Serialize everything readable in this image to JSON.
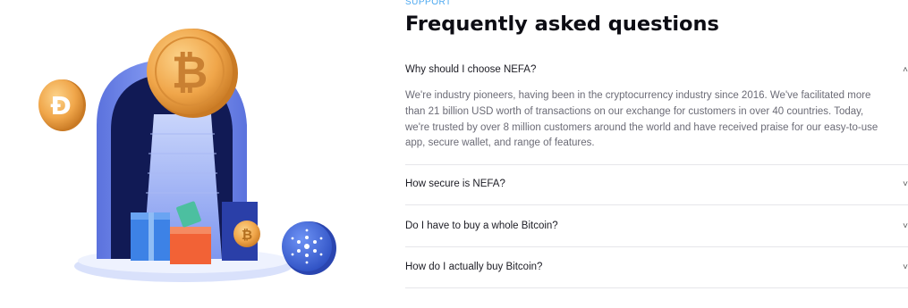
{
  "faq": {
    "eyebrow": "SUPPORT",
    "title": "Frequently asked  questions",
    "items": [
      {
        "question": "Why should I choose NEFA?",
        "expanded": true,
        "answer": "We're industry pioneers, having been in the cryptocurrency industry since 2016. We've facilitated more than 21 billion USD worth of transactions on our exchange for customers in over 40 countries. Today, we're trusted by over 8 million customers around the world and have received praise for our easy-to-use app, secure wallet, and range of features."
      },
      {
        "question": "How secure is NEFA?",
        "expanded": false
      },
      {
        "question": "Do I have to buy a whole Bitcoin?",
        "expanded": false
      },
      {
        "question": "How do I actually buy Bitcoin?",
        "expanded": false
      }
    ],
    "chevron_up": "˄",
    "chevron_down": "˅"
  },
  "illustration": {
    "coin_large_symbol": "₿",
    "coin_small_left_symbol": "Đ",
    "coin_box_symbol": "₿",
    "colors": {
      "accent": "#4aa7f0",
      "arch": "#6f8ef0",
      "gold": "#f0a64a",
      "cardano_blue": "#3d63d8"
    }
  }
}
